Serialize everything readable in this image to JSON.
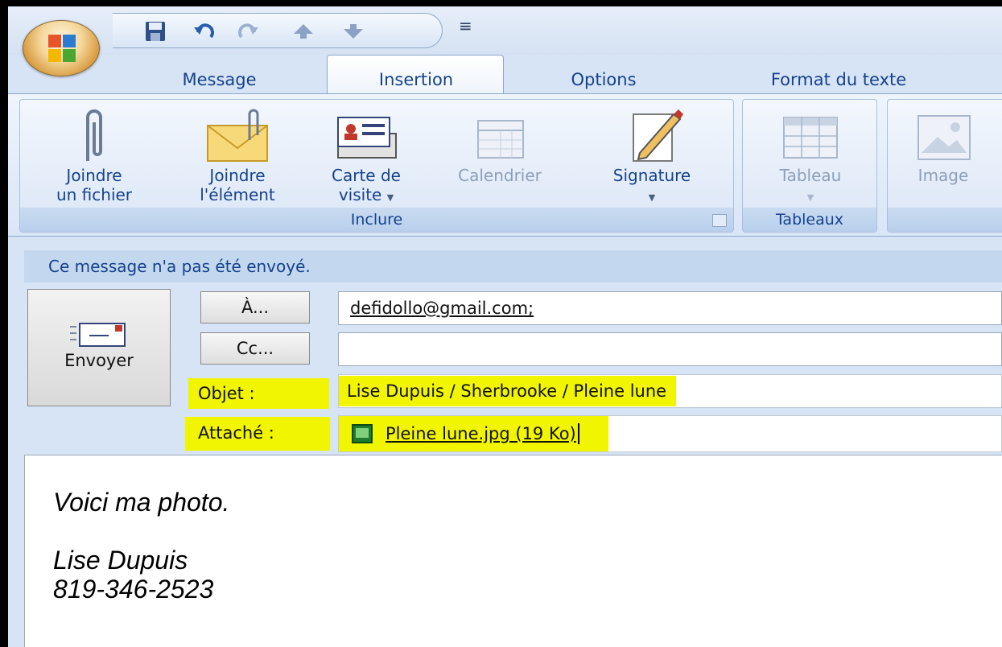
{
  "tabs": [
    {
      "label": "Message"
    },
    {
      "label": "Insertion"
    },
    {
      "label": "Options"
    },
    {
      "label": "Format du texte"
    }
  ],
  "ribbon": {
    "groups": {
      "inclure": {
        "label": "Inclure",
        "buttons": [
          {
            "line1": "Joindre",
            "line2": "un fichier",
            "icon": "paperclip-icon"
          },
          {
            "line1": "Joindre",
            "line2": "l'élément",
            "icon": "envelope-attach-icon"
          },
          {
            "line1": "Carte de",
            "line2": "visite",
            "icon": "business-card-icon"
          },
          {
            "line1": "Calendrier",
            "line2": "",
            "icon": "calendar-icon"
          },
          {
            "line1": "Signature",
            "line2": "",
            "icon": "signature-icon"
          }
        ]
      },
      "tableaux": {
        "label": "Tableaux",
        "buttons": [
          {
            "line1": "Tableau",
            "icon": "table-icon"
          }
        ]
      },
      "illustrations": {
        "buttons": [
          {
            "line1": "Image",
            "icon": "image-icon"
          }
        ]
      }
    }
  },
  "infobar": {
    "text": "Ce message n'a pas été envoyé."
  },
  "compose": {
    "send_label": "Envoyer",
    "to_label": "À...",
    "to_value": "defidollo@gmail.com;",
    "cc_label": "Cc...",
    "cc_value": "",
    "subject_label": "Objet :",
    "subject_value": "Lise Dupuis / Sherbrooke / Pleine lune",
    "attach_label": "Attaché :",
    "attach_value": "Pleine lune.jpg (19 Ko)"
  },
  "body": {
    "line1": "Voici ma photo.",
    "line2": "Lise Dupuis",
    "line3": "819-346-2523"
  },
  "colors": {
    "highlight": "#f2f500",
    "ribbon_text": "#15428b"
  }
}
